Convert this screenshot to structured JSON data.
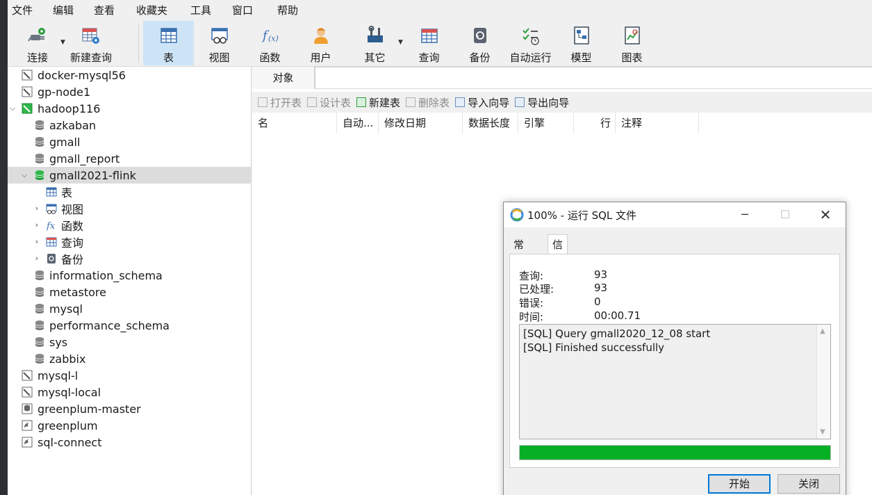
{
  "menu": [
    "文件",
    "编辑",
    "查看",
    "收藏夹",
    "工具",
    "窗口",
    "帮助"
  ],
  "toolbar": {
    "connect": "连接",
    "new_query": "新建查询",
    "table": "表",
    "view": "视图",
    "function": "函数",
    "user": "用户",
    "other": "其它",
    "query": "查询",
    "backup": "备份",
    "auto_run": "自动运行",
    "model": "模型",
    "chart": "图表"
  },
  "tree": {
    "docker_mysql56": "docker-mysql56",
    "gp_node1": "gp-node1",
    "hadoop116": "hadoop116",
    "azkaban": "azkaban",
    "gmall": "gmall",
    "gmall_report": "gmall_report",
    "gmall2021_flink": "gmall2021-flink",
    "tables": "表",
    "views": "视图",
    "functions": "函数",
    "queries": "查询",
    "backups": "备份",
    "information_schema": "information_schema",
    "metastore": "metastore",
    "mysql": "mysql",
    "performance_schema": "performance_schema",
    "sys": "sys",
    "zabbix": "zabbix",
    "mysql_l": "mysql-l",
    "mysql_local": "mysql-local",
    "greenplum_master": "greenplum-master",
    "greenplum": "greenplum",
    "sql_connect": "sql-connect"
  },
  "main": {
    "tab": "对象",
    "actions": {
      "open_table": "打开表",
      "design_table": "设计表",
      "new_table": "新建表",
      "delete_table": "删除表",
      "import_wizard": "导入向导",
      "export_wizard": "导出向导"
    },
    "columns": {
      "name": "名",
      "auto": "自动...",
      "modified": "修改日期",
      "data_length": "数据长度",
      "engine": "引擎",
      "rows": "行",
      "comment": "注释"
    }
  },
  "dialog": {
    "title": "100% - 运行 SQL 文件",
    "tab_general": "常规",
    "tab_log": "信息日志",
    "stats": {
      "query_label": "查询:",
      "query_value": "93",
      "processed_label": "已处理:",
      "processed_value": "93",
      "errors_label": "错误:",
      "errors_value": "0",
      "time_label": "时间:",
      "time_value": "00:00.71"
    },
    "log": [
      "[SQL] Query gmall2020_12_08 start",
      "[SQL] Finished successfully"
    ],
    "progress": 1.0,
    "start_button": "开始",
    "close_button": "关闭",
    "colors": {
      "progress": "#06b025",
      "accent": "#0078d7"
    }
  }
}
